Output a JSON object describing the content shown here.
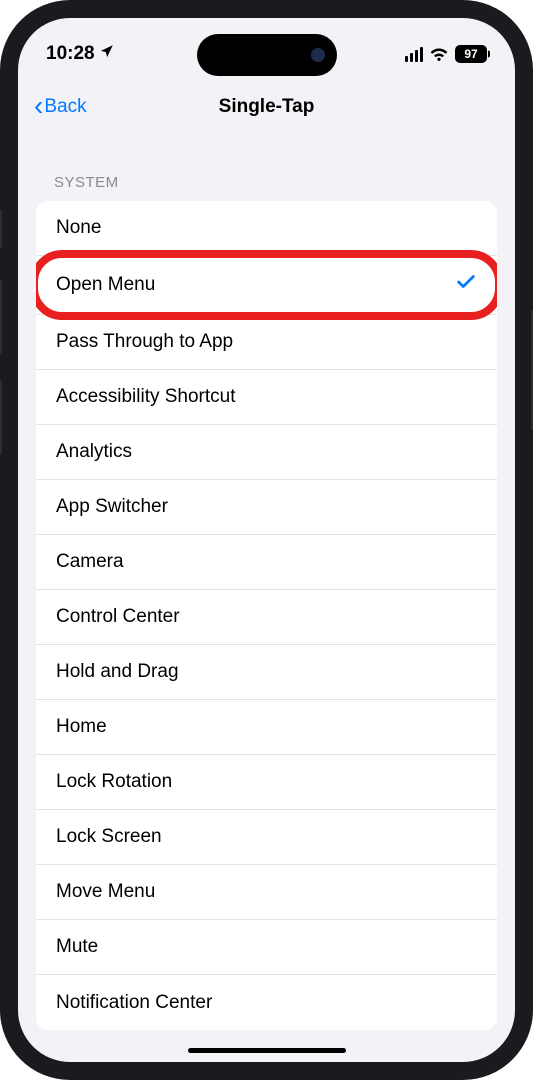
{
  "status": {
    "time": "10:28",
    "battery": "97"
  },
  "nav": {
    "back": "Back",
    "title": "Single-Tap"
  },
  "section": {
    "header": "SYSTEM"
  },
  "items": [
    {
      "label": "None",
      "selected": false,
      "highlight": false
    },
    {
      "label": "Open Menu",
      "selected": true,
      "highlight": true
    },
    {
      "label": "Pass Through to App",
      "selected": false,
      "highlight": false
    },
    {
      "label": "Accessibility Shortcut",
      "selected": false,
      "highlight": false
    },
    {
      "label": "Analytics",
      "selected": false,
      "highlight": false
    },
    {
      "label": "App Switcher",
      "selected": false,
      "highlight": false
    },
    {
      "label": "Camera",
      "selected": false,
      "highlight": false
    },
    {
      "label": "Control Center",
      "selected": false,
      "highlight": false
    },
    {
      "label": "Hold and Drag",
      "selected": false,
      "highlight": false
    },
    {
      "label": "Home",
      "selected": false,
      "highlight": false
    },
    {
      "label": "Lock Rotation",
      "selected": false,
      "highlight": false
    },
    {
      "label": "Lock Screen",
      "selected": false,
      "highlight": false
    },
    {
      "label": "Move Menu",
      "selected": false,
      "highlight": false
    },
    {
      "label": "Mute",
      "selected": false,
      "highlight": false
    },
    {
      "label": "Notification Center",
      "selected": false,
      "highlight": false
    }
  ]
}
